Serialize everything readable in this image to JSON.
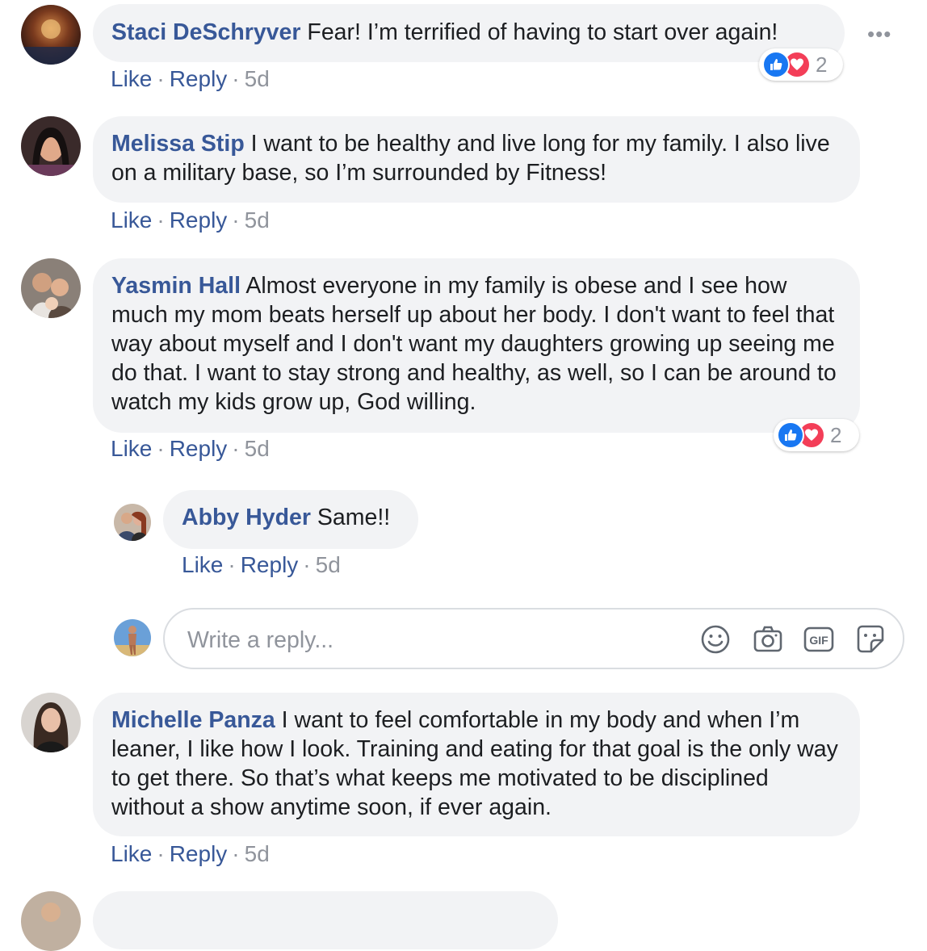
{
  "menu": {
    "more_label": "•••"
  },
  "comments": [
    {
      "name": "Staci DeSchryver",
      "text": "Fear! I’m terrified of having to start over again!",
      "actions": {
        "like": "Like",
        "reply": "Reply",
        "time": "5d"
      },
      "reactions": {
        "count": "2",
        "types": [
          "like",
          "love"
        ]
      }
    },
    {
      "name": "Melissa Stip",
      "text": "I want to be healthy and live long for my family. I also live on a military base, so I’m surrounded by Fitness!",
      "actions": {
        "like": "Like",
        "reply": "Reply",
        "time": "5d"
      }
    },
    {
      "name": "Yasmin Hall",
      "text": "Almost everyone in my family is obese and I see how much my mom beats herself up about her body. I don't want to feel that way about myself and I don't want my daughters growing up seeing me do that. I want to stay strong and healthy, as well, so I can be around to watch my kids grow up, God willing.",
      "actions": {
        "like": "Like",
        "reply": "Reply",
        "time": "5d"
      },
      "reactions": {
        "count": "2",
        "types": [
          "like",
          "love"
        ]
      },
      "replies": [
        {
          "name": "Abby Hyder",
          "text": "Same!!",
          "actions": {
            "like": "Like",
            "reply": "Reply",
            "time": "5d"
          }
        }
      ]
    },
    {
      "name": "Michelle Panza",
      "text": "I want to feel comfortable in my body and when I’m leaner, I like how I look. Training and eating for that goal is the only way to get there. So that’s what keeps me motivated to be disciplined without a show anytime soon, if ever again.",
      "actions": {
        "like": "Like",
        "reply": "Reply",
        "time": "5d"
      }
    }
  ],
  "reply_box": {
    "placeholder": "Write a reply...",
    "icons": [
      "emoji-icon",
      "camera-icon",
      "gif-icon",
      "sticker-icon"
    ]
  },
  "colors": {
    "name_link": "#385898",
    "bubble_bg": "#f2f3f5",
    "meta_gray": "#90949c",
    "like_blue": "#1877f2",
    "love_red": "#f33e58"
  }
}
